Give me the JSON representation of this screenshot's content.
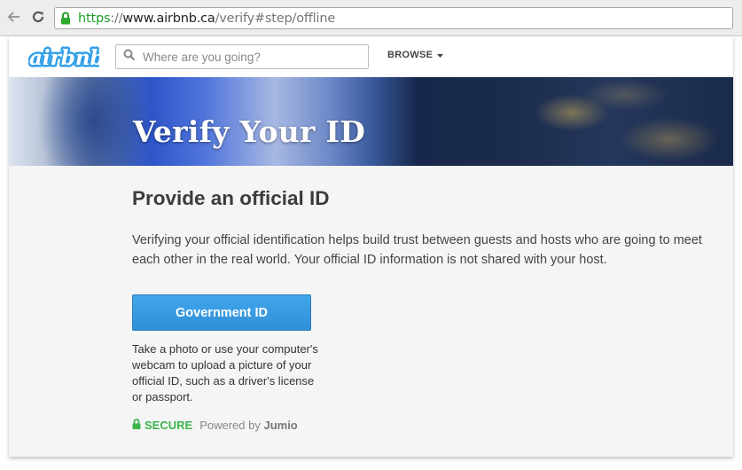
{
  "browser": {
    "url_scheme": "https",
    "url_sep": "://",
    "url_host": "www.airbnb.ca",
    "url_path": "/verify#step/offline"
  },
  "header": {
    "logo_text": "airbnb",
    "search_placeholder": "Where are you going?",
    "browse_label": "BROWSE"
  },
  "hero": {
    "title": "Verify Your ID"
  },
  "main": {
    "heading": "Provide an official ID",
    "description": "Verifying your official identification helps build trust between guests and hosts who are going to meet each other in the real world. Your official ID information is not shared with your host.",
    "government_id_button": "Government ID",
    "button_description": "Take a photo or use your computer's webcam to upload a picture of your official ID, such as a driver's license or passport.",
    "secure_label": "SECURE",
    "powered_by": "Powered by",
    "provider": "Jumio"
  },
  "colors": {
    "brand_blue": "#35a0e8",
    "secure_green": "#3ab54a",
    "https_green": "#1e9e2a"
  },
  "icons": [
    "back-arrow-icon",
    "reload-icon",
    "lock-icon",
    "search-icon",
    "caret-down-icon",
    "secure-lock-icon"
  ]
}
